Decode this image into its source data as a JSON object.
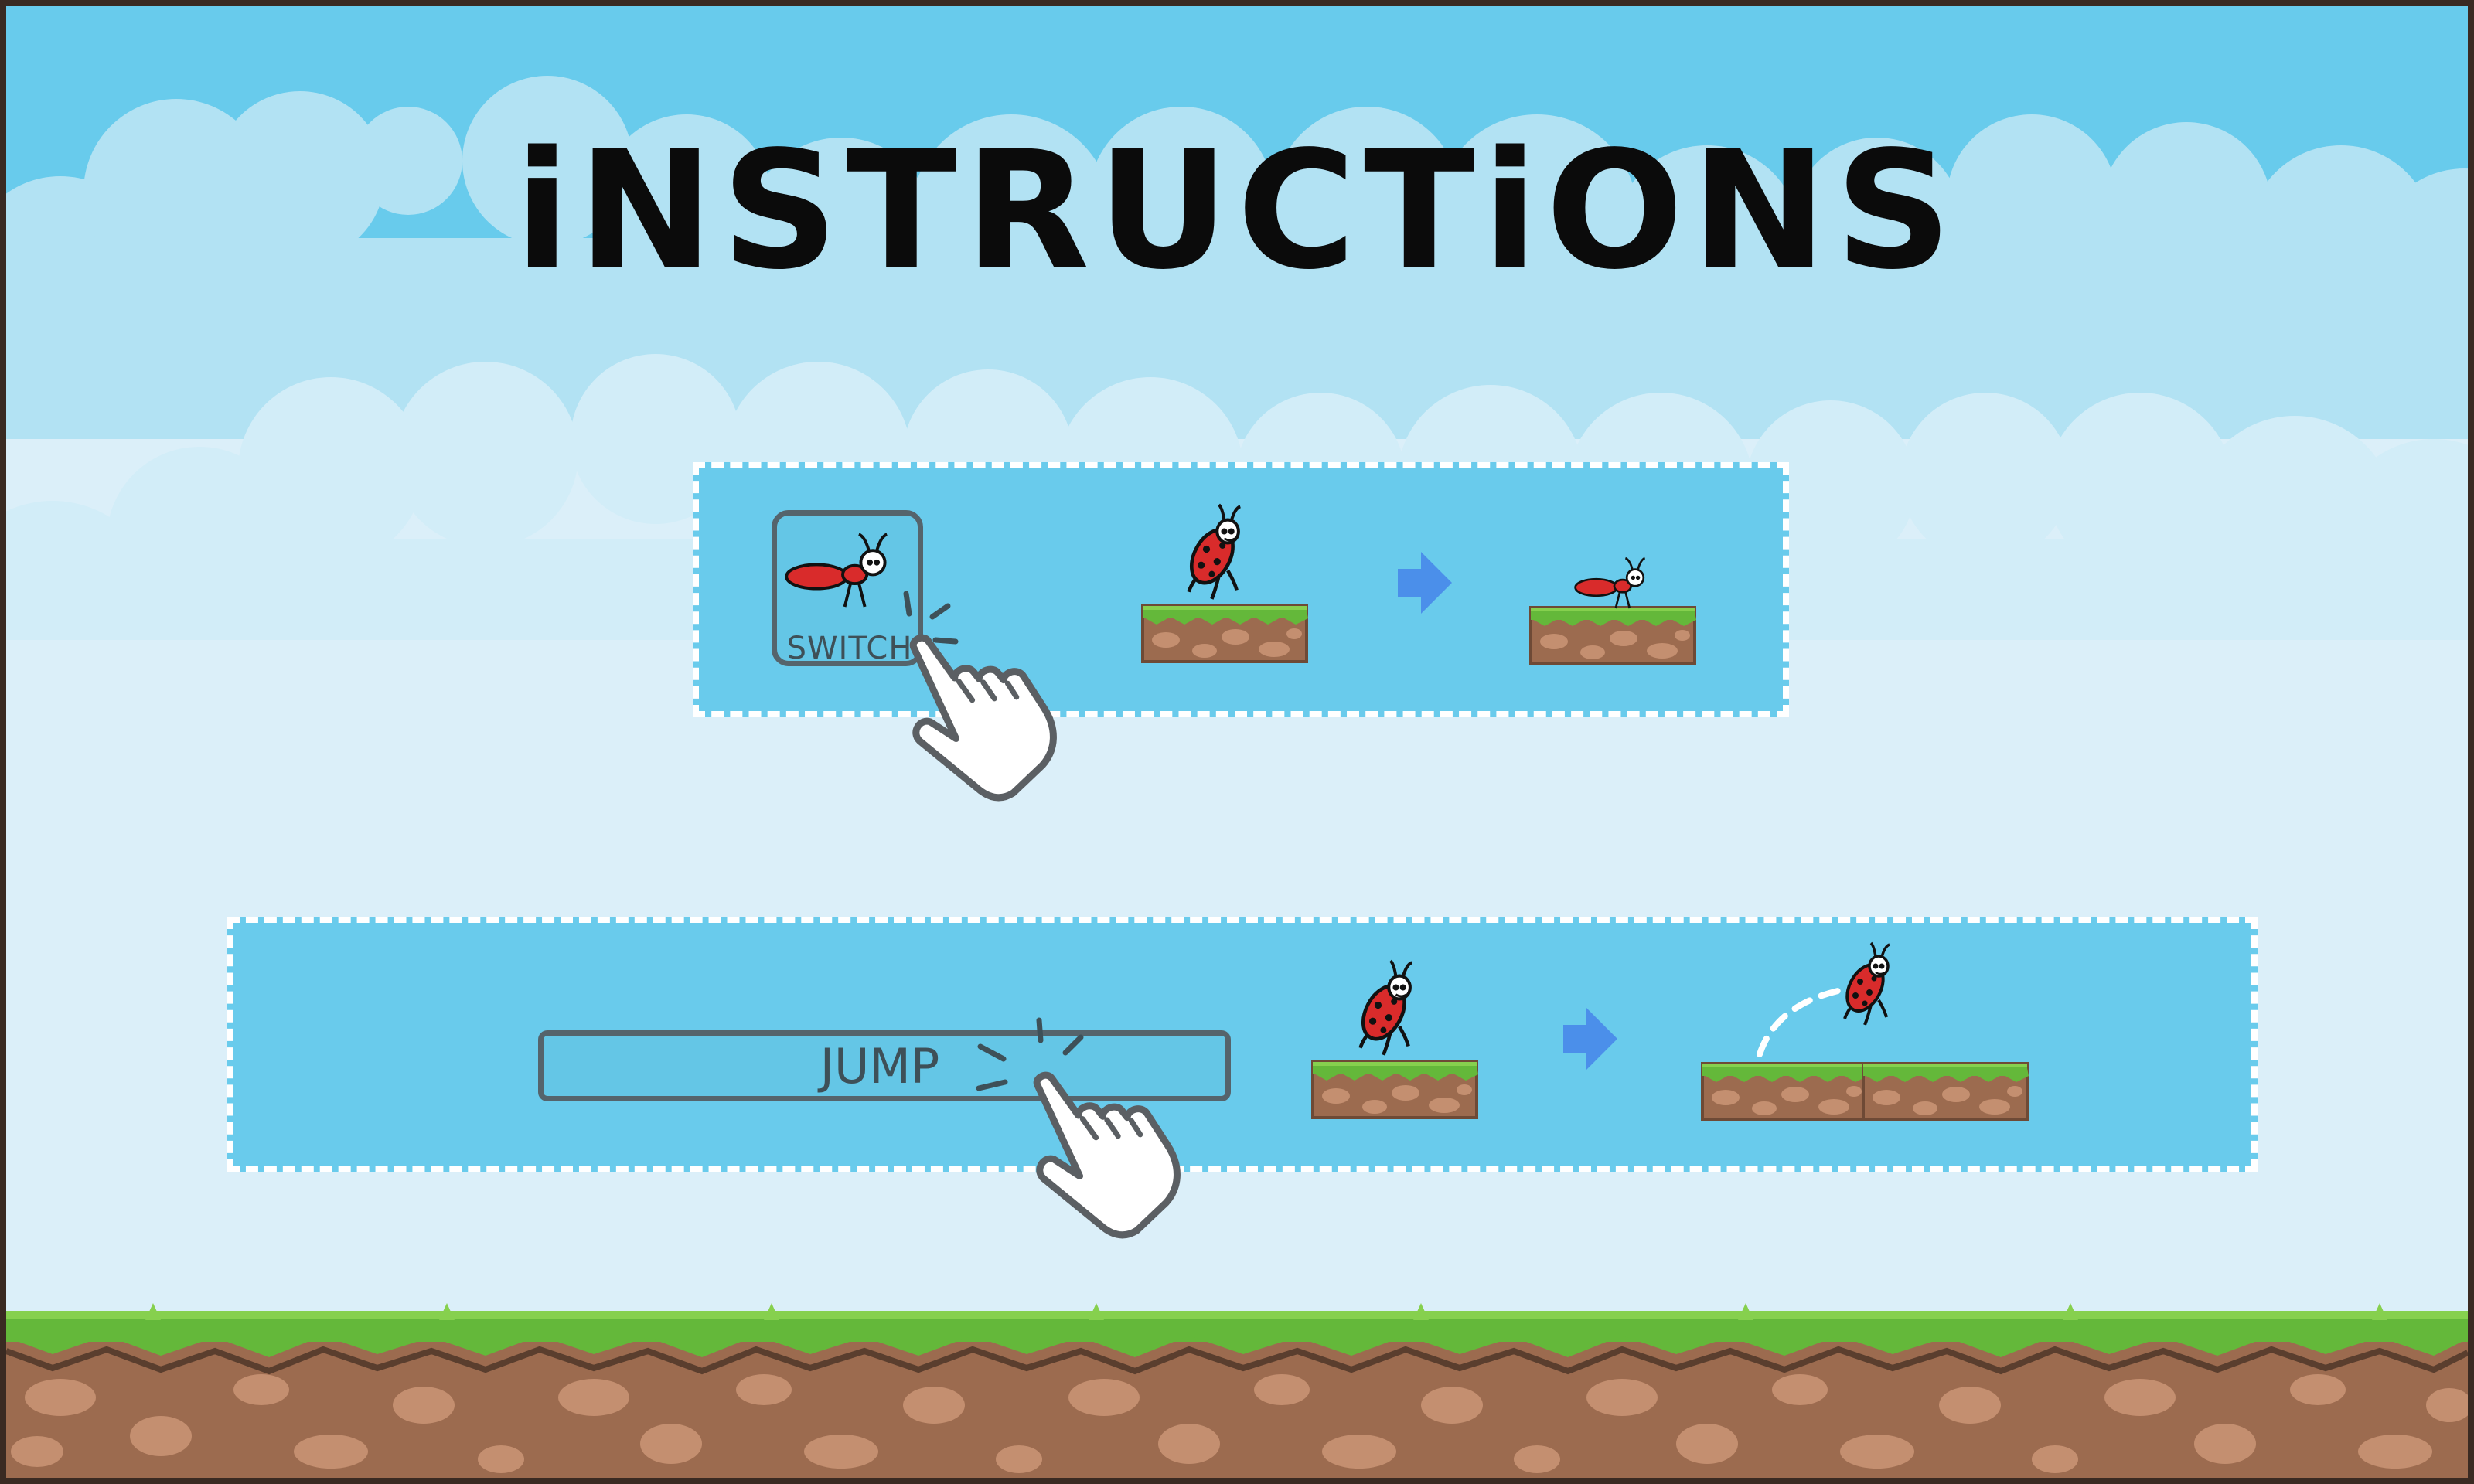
{
  "screen": {
    "title": "iNSTRUCTiONS"
  },
  "instructions": [
    {
      "button_label": "SWITCH",
      "button_icon": "ant-icon",
      "gesture": "tap-hand-icon",
      "before": "ladybug-on-platform",
      "arrow": "right-arrow-icon",
      "after": "ant-on-platform"
    },
    {
      "button_label": "JUMP",
      "gesture": "tap-hand-icon",
      "before": "ladybug-on-platform",
      "arrow": "right-arrow-icon",
      "after": "ladybug-jumping-over-platform"
    }
  ],
  "colors": {
    "sky_top": "#68cbec",
    "sky_bottom": "#dbeff9",
    "panel": "#69cbec",
    "panel_border": "#ffffff",
    "arrow": "#4b8fea",
    "grass": "#64b83a",
    "dirt": "#9c6b4f",
    "stone": "#c48f70",
    "title": "#0b0b0b",
    "button_outline": "#55646c"
  }
}
